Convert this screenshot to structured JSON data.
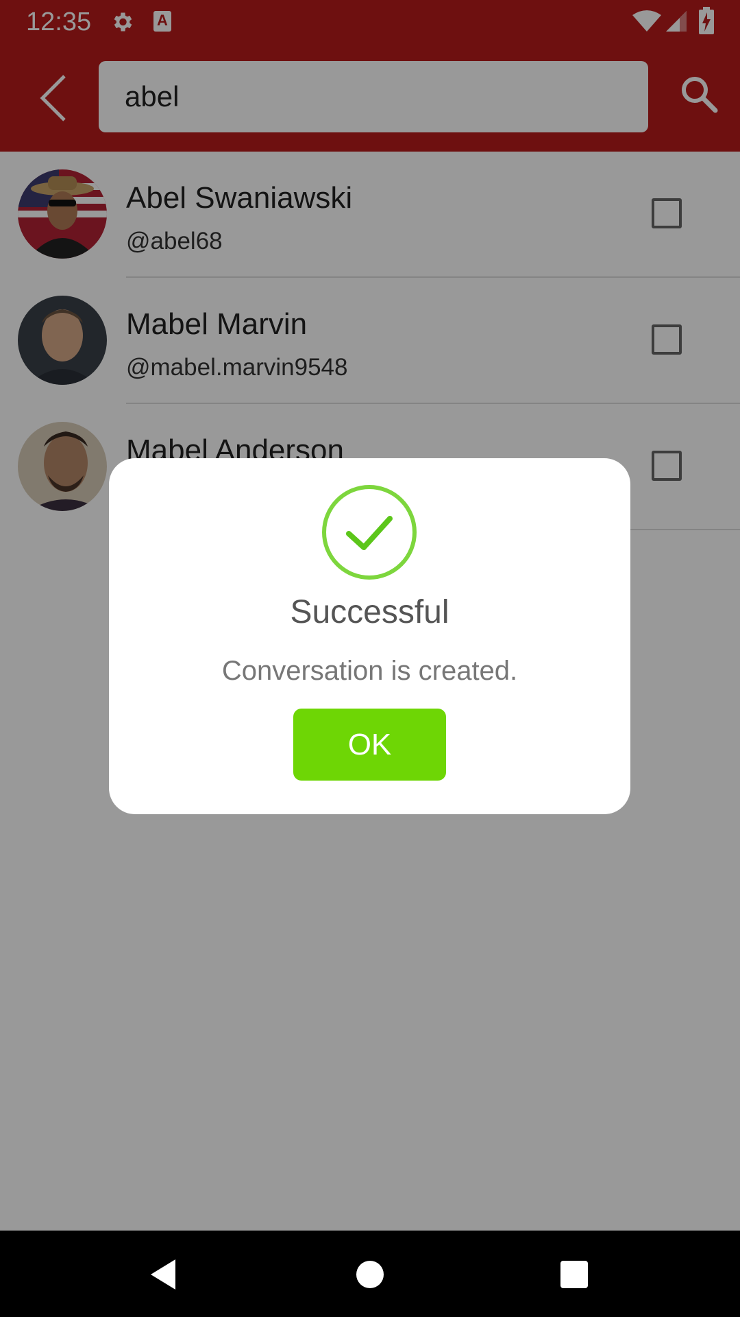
{
  "status_bar": {
    "time": "12:35",
    "settings_icon": "gear-icon",
    "notification_glyph": "A",
    "wifi_icon": "wifi-icon",
    "signal_icon": "signal-icon",
    "battery_icon": "battery-charging-icon"
  },
  "app_bar": {
    "back_icon": "chevron-left-icon",
    "search_value": "abel",
    "search_icon": "search-icon"
  },
  "contacts": [
    {
      "name": "Abel Swaniawski",
      "handle": "@abel68",
      "checked": false
    },
    {
      "name": "Mabel Marvin",
      "handle": "@mabel.marvin9548",
      "checked": false
    },
    {
      "name": "Mabel Anderson",
      "handle": "",
      "checked": false
    }
  ],
  "dialog": {
    "icon": "check-circle-icon",
    "title": "Successful",
    "message": "Conversation is created.",
    "ok_label": "OK"
  },
  "colors": {
    "primary": "#b71c1c",
    "success": "#6ed605",
    "success_icon": "#7dd63d"
  },
  "nav_bar": {
    "back_icon": "triangle-back-icon",
    "home_icon": "circle-home-icon",
    "recents_icon": "square-recents-icon"
  }
}
